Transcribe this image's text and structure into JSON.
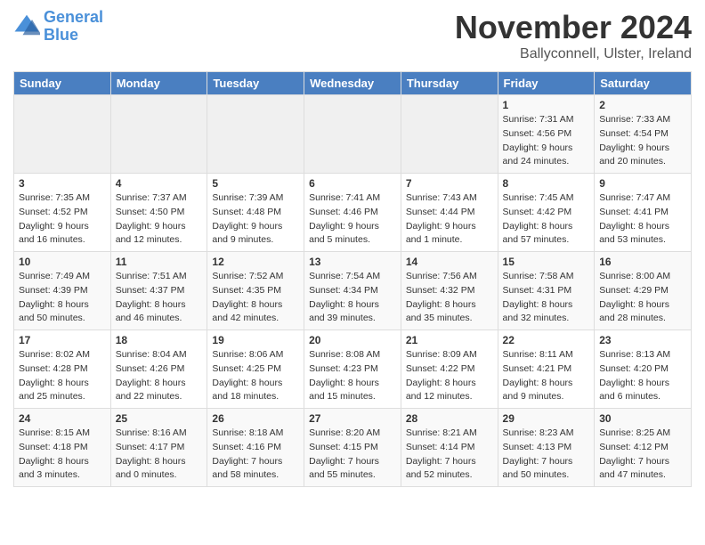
{
  "header": {
    "logo_line1": "General",
    "logo_line2": "Blue",
    "title": "November 2024",
    "location": "Ballyconnell, Ulster, Ireland"
  },
  "weekdays": [
    "Sunday",
    "Monday",
    "Tuesday",
    "Wednesday",
    "Thursday",
    "Friday",
    "Saturday"
  ],
  "weeks": [
    [
      {
        "day": "",
        "info": ""
      },
      {
        "day": "",
        "info": ""
      },
      {
        "day": "",
        "info": ""
      },
      {
        "day": "",
        "info": ""
      },
      {
        "day": "",
        "info": ""
      },
      {
        "day": "1",
        "info": "Sunrise: 7:31 AM\nSunset: 4:56 PM\nDaylight: 9 hours and 24 minutes."
      },
      {
        "day": "2",
        "info": "Sunrise: 7:33 AM\nSunset: 4:54 PM\nDaylight: 9 hours and 20 minutes."
      }
    ],
    [
      {
        "day": "3",
        "info": "Sunrise: 7:35 AM\nSunset: 4:52 PM\nDaylight: 9 hours and 16 minutes."
      },
      {
        "day": "4",
        "info": "Sunrise: 7:37 AM\nSunset: 4:50 PM\nDaylight: 9 hours and 12 minutes."
      },
      {
        "day": "5",
        "info": "Sunrise: 7:39 AM\nSunset: 4:48 PM\nDaylight: 9 hours and 9 minutes."
      },
      {
        "day": "6",
        "info": "Sunrise: 7:41 AM\nSunset: 4:46 PM\nDaylight: 9 hours and 5 minutes."
      },
      {
        "day": "7",
        "info": "Sunrise: 7:43 AM\nSunset: 4:44 PM\nDaylight: 9 hours and 1 minute."
      },
      {
        "day": "8",
        "info": "Sunrise: 7:45 AM\nSunset: 4:42 PM\nDaylight: 8 hours and 57 minutes."
      },
      {
        "day": "9",
        "info": "Sunrise: 7:47 AM\nSunset: 4:41 PM\nDaylight: 8 hours and 53 minutes."
      }
    ],
    [
      {
        "day": "10",
        "info": "Sunrise: 7:49 AM\nSunset: 4:39 PM\nDaylight: 8 hours and 50 minutes."
      },
      {
        "day": "11",
        "info": "Sunrise: 7:51 AM\nSunset: 4:37 PM\nDaylight: 8 hours and 46 minutes."
      },
      {
        "day": "12",
        "info": "Sunrise: 7:52 AM\nSunset: 4:35 PM\nDaylight: 8 hours and 42 minutes."
      },
      {
        "day": "13",
        "info": "Sunrise: 7:54 AM\nSunset: 4:34 PM\nDaylight: 8 hours and 39 minutes."
      },
      {
        "day": "14",
        "info": "Sunrise: 7:56 AM\nSunset: 4:32 PM\nDaylight: 8 hours and 35 minutes."
      },
      {
        "day": "15",
        "info": "Sunrise: 7:58 AM\nSunset: 4:31 PM\nDaylight: 8 hours and 32 minutes."
      },
      {
        "day": "16",
        "info": "Sunrise: 8:00 AM\nSunset: 4:29 PM\nDaylight: 8 hours and 28 minutes."
      }
    ],
    [
      {
        "day": "17",
        "info": "Sunrise: 8:02 AM\nSunset: 4:28 PM\nDaylight: 8 hours and 25 minutes."
      },
      {
        "day": "18",
        "info": "Sunrise: 8:04 AM\nSunset: 4:26 PM\nDaylight: 8 hours and 22 minutes."
      },
      {
        "day": "19",
        "info": "Sunrise: 8:06 AM\nSunset: 4:25 PM\nDaylight: 8 hours and 18 minutes."
      },
      {
        "day": "20",
        "info": "Sunrise: 8:08 AM\nSunset: 4:23 PM\nDaylight: 8 hours and 15 minutes."
      },
      {
        "day": "21",
        "info": "Sunrise: 8:09 AM\nSunset: 4:22 PM\nDaylight: 8 hours and 12 minutes."
      },
      {
        "day": "22",
        "info": "Sunrise: 8:11 AM\nSunset: 4:21 PM\nDaylight: 8 hours and 9 minutes."
      },
      {
        "day": "23",
        "info": "Sunrise: 8:13 AM\nSunset: 4:20 PM\nDaylight: 8 hours and 6 minutes."
      }
    ],
    [
      {
        "day": "24",
        "info": "Sunrise: 8:15 AM\nSunset: 4:18 PM\nDaylight: 8 hours and 3 minutes."
      },
      {
        "day": "25",
        "info": "Sunrise: 8:16 AM\nSunset: 4:17 PM\nDaylight: 8 hours and 0 minutes."
      },
      {
        "day": "26",
        "info": "Sunrise: 8:18 AM\nSunset: 4:16 PM\nDaylight: 7 hours and 58 minutes."
      },
      {
        "day": "27",
        "info": "Sunrise: 8:20 AM\nSunset: 4:15 PM\nDaylight: 7 hours and 55 minutes."
      },
      {
        "day": "28",
        "info": "Sunrise: 8:21 AM\nSunset: 4:14 PM\nDaylight: 7 hours and 52 minutes."
      },
      {
        "day": "29",
        "info": "Sunrise: 8:23 AM\nSunset: 4:13 PM\nDaylight: 7 hours and 50 minutes."
      },
      {
        "day": "30",
        "info": "Sunrise: 8:25 AM\nSunset: 4:12 PM\nDaylight: 7 hours and 47 minutes."
      }
    ]
  ]
}
